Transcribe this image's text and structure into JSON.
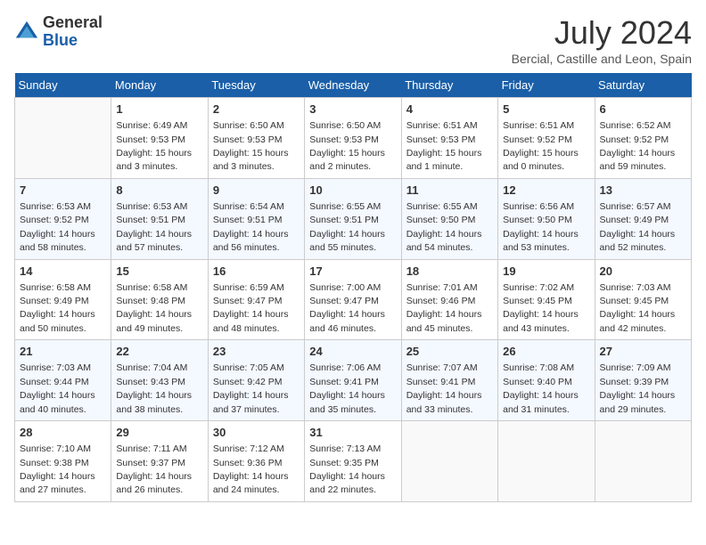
{
  "logo": {
    "general": "General",
    "blue": "Blue"
  },
  "header": {
    "title": "July 2024",
    "location": "Bercial, Castille and Leon, Spain"
  },
  "weekdays": [
    "Sunday",
    "Monday",
    "Tuesday",
    "Wednesday",
    "Thursday",
    "Friday",
    "Saturday"
  ],
  "weeks": [
    [
      {
        "day": "",
        "sunrise": "",
        "sunset": "",
        "daylight": ""
      },
      {
        "day": "1",
        "sunrise": "Sunrise: 6:49 AM",
        "sunset": "Sunset: 9:53 PM",
        "daylight": "Daylight: 15 hours and 3 minutes."
      },
      {
        "day": "2",
        "sunrise": "Sunrise: 6:50 AM",
        "sunset": "Sunset: 9:53 PM",
        "daylight": "Daylight: 15 hours and 3 minutes."
      },
      {
        "day": "3",
        "sunrise": "Sunrise: 6:50 AM",
        "sunset": "Sunset: 9:53 PM",
        "daylight": "Daylight: 15 hours and 2 minutes."
      },
      {
        "day": "4",
        "sunrise": "Sunrise: 6:51 AM",
        "sunset": "Sunset: 9:53 PM",
        "daylight": "Daylight: 15 hours and 1 minute."
      },
      {
        "day": "5",
        "sunrise": "Sunrise: 6:51 AM",
        "sunset": "Sunset: 9:52 PM",
        "daylight": "Daylight: 15 hours and 0 minutes."
      },
      {
        "day": "6",
        "sunrise": "Sunrise: 6:52 AM",
        "sunset": "Sunset: 9:52 PM",
        "daylight": "Daylight: 14 hours and 59 minutes."
      }
    ],
    [
      {
        "day": "7",
        "sunrise": "Sunrise: 6:53 AM",
        "sunset": "Sunset: 9:52 PM",
        "daylight": "Daylight: 14 hours and 58 minutes."
      },
      {
        "day": "8",
        "sunrise": "Sunrise: 6:53 AM",
        "sunset": "Sunset: 9:51 PM",
        "daylight": "Daylight: 14 hours and 57 minutes."
      },
      {
        "day": "9",
        "sunrise": "Sunrise: 6:54 AM",
        "sunset": "Sunset: 9:51 PM",
        "daylight": "Daylight: 14 hours and 56 minutes."
      },
      {
        "day": "10",
        "sunrise": "Sunrise: 6:55 AM",
        "sunset": "Sunset: 9:51 PM",
        "daylight": "Daylight: 14 hours and 55 minutes."
      },
      {
        "day": "11",
        "sunrise": "Sunrise: 6:55 AM",
        "sunset": "Sunset: 9:50 PM",
        "daylight": "Daylight: 14 hours and 54 minutes."
      },
      {
        "day": "12",
        "sunrise": "Sunrise: 6:56 AM",
        "sunset": "Sunset: 9:50 PM",
        "daylight": "Daylight: 14 hours and 53 minutes."
      },
      {
        "day": "13",
        "sunrise": "Sunrise: 6:57 AM",
        "sunset": "Sunset: 9:49 PM",
        "daylight": "Daylight: 14 hours and 52 minutes."
      }
    ],
    [
      {
        "day": "14",
        "sunrise": "Sunrise: 6:58 AM",
        "sunset": "Sunset: 9:49 PM",
        "daylight": "Daylight: 14 hours and 50 minutes."
      },
      {
        "day": "15",
        "sunrise": "Sunrise: 6:58 AM",
        "sunset": "Sunset: 9:48 PM",
        "daylight": "Daylight: 14 hours and 49 minutes."
      },
      {
        "day": "16",
        "sunrise": "Sunrise: 6:59 AM",
        "sunset": "Sunset: 9:47 PM",
        "daylight": "Daylight: 14 hours and 48 minutes."
      },
      {
        "day": "17",
        "sunrise": "Sunrise: 7:00 AM",
        "sunset": "Sunset: 9:47 PM",
        "daylight": "Daylight: 14 hours and 46 minutes."
      },
      {
        "day": "18",
        "sunrise": "Sunrise: 7:01 AM",
        "sunset": "Sunset: 9:46 PM",
        "daylight": "Daylight: 14 hours and 45 minutes."
      },
      {
        "day": "19",
        "sunrise": "Sunrise: 7:02 AM",
        "sunset": "Sunset: 9:45 PM",
        "daylight": "Daylight: 14 hours and 43 minutes."
      },
      {
        "day": "20",
        "sunrise": "Sunrise: 7:03 AM",
        "sunset": "Sunset: 9:45 PM",
        "daylight": "Daylight: 14 hours and 42 minutes."
      }
    ],
    [
      {
        "day": "21",
        "sunrise": "Sunrise: 7:03 AM",
        "sunset": "Sunset: 9:44 PM",
        "daylight": "Daylight: 14 hours and 40 minutes."
      },
      {
        "day": "22",
        "sunrise": "Sunrise: 7:04 AM",
        "sunset": "Sunset: 9:43 PM",
        "daylight": "Daylight: 14 hours and 38 minutes."
      },
      {
        "day": "23",
        "sunrise": "Sunrise: 7:05 AM",
        "sunset": "Sunset: 9:42 PM",
        "daylight": "Daylight: 14 hours and 37 minutes."
      },
      {
        "day": "24",
        "sunrise": "Sunrise: 7:06 AM",
        "sunset": "Sunset: 9:41 PM",
        "daylight": "Daylight: 14 hours and 35 minutes."
      },
      {
        "day": "25",
        "sunrise": "Sunrise: 7:07 AM",
        "sunset": "Sunset: 9:41 PM",
        "daylight": "Daylight: 14 hours and 33 minutes."
      },
      {
        "day": "26",
        "sunrise": "Sunrise: 7:08 AM",
        "sunset": "Sunset: 9:40 PM",
        "daylight": "Daylight: 14 hours and 31 minutes."
      },
      {
        "day": "27",
        "sunrise": "Sunrise: 7:09 AM",
        "sunset": "Sunset: 9:39 PM",
        "daylight": "Daylight: 14 hours and 29 minutes."
      }
    ],
    [
      {
        "day": "28",
        "sunrise": "Sunrise: 7:10 AM",
        "sunset": "Sunset: 9:38 PM",
        "daylight": "Daylight: 14 hours and 27 minutes."
      },
      {
        "day": "29",
        "sunrise": "Sunrise: 7:11 AM",
        "sunset": "Sunset: 9:37 PM",
        "daylight": "Daylight: 14 hours and 26 minutes."
      },
      {
        "day": "30",
        "sunrise": "Sunrise: 7:12 AM",
        "sunset": "Sunset: 9:36 PM",
        "daylight": "Daylight: 14 hours and 24 minutes."
      },
      {
        "day": "31",
        "sunrise": "Sunrise: 7:13 AM",
        "sunset": "Sunset: 9:35 PM",
        "daylight": "Daylight: 14 hours and 22 minutes."
      },
      {
        "day": "",
        "sunrise": "",
        "sunset": "",
        "daylight": ""
      },
      {
        "day": "",
        "sunrise": "",
        "sunset": "",
        "daylight": ""
      },
      {
        "day": "",
        "sunrise": "",
        "sunset": "",
        "daylight": ""
      }
    ]
  ]
}
